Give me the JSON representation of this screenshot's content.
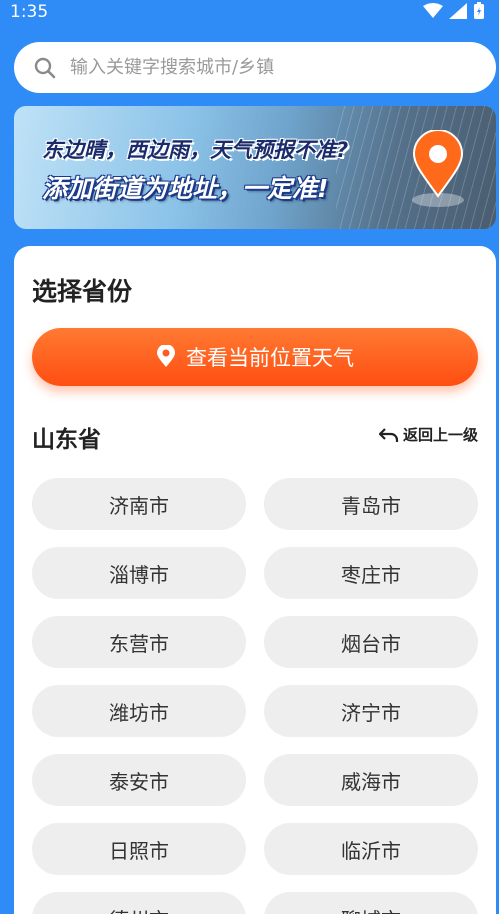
{
  "status_bar": {
    "time": "1:35"
  },
  "search": {
    "placeholder": "输入关键字搜索城市/乡镇"
  },
  "banner": {
    "line1": "东边晴，西边雨，天气预报不准?",
    "line2": "添加街道为地址，一定准!"
  },
  "panel": {
    "title": "选择省份",
    "locate_label": "查看当前位置天气",
    "province": "山东省",
    "back_label": "返回上一级"
  },
  "cities": [
    "济南市",
    "青岛市",
    "淄博市",
    "枣庄市",
    "东营市",
    "烟台市",
    "潍坊市",
    "济宁市",
    "泰安市",
    "威海市",
    "日照市",
    "临沂市",
    "德州市",
    "聊城市"
  ],
  "colors": {
    "background": "#2f8bf6",
    "accent": "#ff5a1f",
    "chip": "#eeeeee"
  }
}
